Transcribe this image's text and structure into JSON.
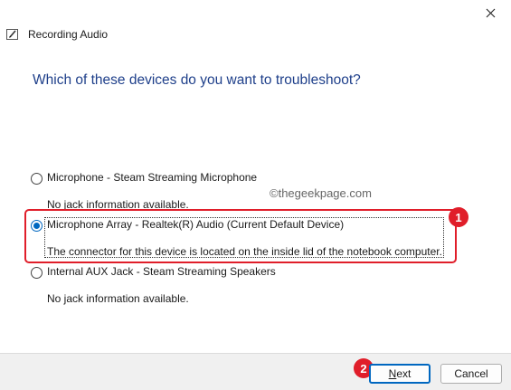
{
  "window": {
    "title": "Recording Audio",
    "icon": "pen-audio-icon"
  },
  "heading": "Which of these devices do you want to troubleshoot?",
  "devices": [
    {
      "name": "Microphone - Steam Streaming Microphone",
      "description": "No jack information available.",
      "selected": false
    },
    {
      "name": "Microphone Array - Realtek(R) Audio (Current Default Device)",
      "description": "The connector for this device is located on the inside lid of the notebook computer.",
      "selected": true
    },
    {
      "name": "Internal AUX Jack - Steam Streaming Speakers",
      "description": "No jack information available.",
      "selected": false
    }
  ],
  "watermark": "©thegeekpage.com",
  "annotations": {
    "badge_1": "1",
    "badge_2": "2",
    "highlight_color": "#e01e2a"
  },
  "buttons": {
    "next_label": "Next",
    "next_mnemonic": "N",
    "next_rest": "ext",
    "cancel_label": "Cancel"
  },
  "colors": {
    "heading": "#1e3f8a",
    "accent": "#0067c0"
  }
}
